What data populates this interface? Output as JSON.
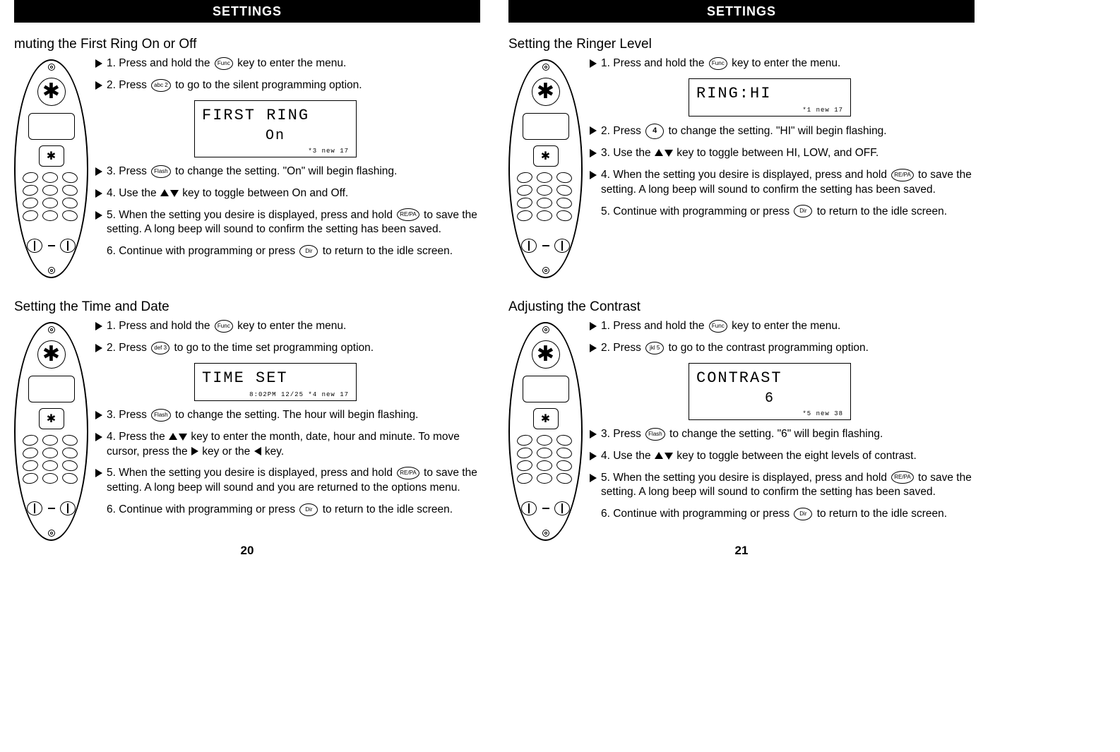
{
  "header": "SETTINGS",
  "page_left_num": "20",
  "page_right_num": "21",
  "buttons": {
    "func": "Func",
    "flash": "Flash",
    "repa": "RE/PA",
    "dir": "Dir",
    "k2": "abc 2",
    "k3": "def 3",
    "k4": "4",
    "k5": "jkl 5"
  },
  "sections": {
    "mute": {
      "title": "muting the First Ring  On or Off",
      "lcd": {
        "l1": "FIRST RING",
        "l2": "On",
        "l3": "*3    new 17"
      },
      "steps": [
        {
          "arrow": true,
          "n": "1.",
          "pre": "Press and hold the",
          "btn": "func",
          "post": "key to enter the menu."
        },
        {
          "arrow": true,
          "n": "2.",
          "pre": "Press",
          "btn": "k2",
          "post": "to go to the silent programming option."
        },
        {
          "arrow": true,
          "n": "3.",
          "pre": "Press",
          "btn": "flash",
          "post": "to change the setting.  \"On\"  will begin flashing."
        },
        {
          "arrow": true,
          "n": "4.",
          "pre": "Use the",
          "updown": true,
          "post": "key to toggle between On and Off."
        },
        {
          "arrow": true,
          "n": "5.",
          "pre": "When the setting you desire is displayed, press and hold",
          "btn": "repa",
          "post": "to save the setting. A long beep will sound to confirm the setting has been saved."
        },
        {
          "arrow": false,
          "n": "6.",
          "pre": "Continue with programming or press",
          "btn": "dir",
          "post": "to return to the idle screen."
        }
      ]
    },
    "time": {
      "title": "Setting the Time and Date",
      "lcd": {
        "l1": "TIME SET",
        "l2": " ",
        "l3": "8:02PM  12/25    *4    new 17"
      },
      "steps": [
        {
          "arrow": true,
          "n": "1.",
          "pre": "Press and hold the",
          "btn": "func",
          "post": "key to enter the menu."
        },
        {
          "arrow": true,
          "n": "2.",
          "pre": "Press",
          "btn": "k3",
          "post": "to go to the time set programming option."
        },
        {
          "arrow": true,
          "n": "3.",
          "pre": "Press",
          "btn": "flash",
          "post": "to change the setting. The hour  will begin flashing."
        },
        {
          "arrow": true,
          "n": "4.",
          "pre": "Press the",
          "updown": true,
          "post": "key to enter the month, date, hour and minute. To move cursor, press the",
          "rtri": true,
          "post2": "key or the",
          "ltri": true,
          "post3": "key."
        },
        {
          "arrow": true,
          "n": "5.",
          "pre": "When the setting you desire is displayed, press and hold",
          "btn": "repa",
          "post": "to save the setting. A long beep will sound and you are returned to the options menu."
        },
        {
          "arrow": false,
          "n": "6.",
          "pre": "Continue with programming or press",
          "btn": "dir",
          "post": "to return to the idle screen."
        }
      ]
    },
    "ringer": {
      "title": "Setting the Ringer Level",
      "lcd": {
        "l1": "RING:HI",
        "l2": " ",
        "l3": "*1    new 17"
      },
      "steps": [
        {
          "arrow": true,
          "n": "1.",
          "pre": "Press and hold the",
          "btn": "func",
          "post": "key to enter the menu."
        },
        {
          "arrow": true,
          "n": "2.",
          "pre": "Press",
          "btn": "k4",
          "big": true,
          "post": "to change the setting.  \"HI\"  will begin flashing."
        },
        {
          "arrow": true,
          "n": "3.",
          "pre": "Use the",
          "updown": true,
          "post": "key to toggle between HI, LOW, and OFF."
        },
        {
          "arrow": true,
          "n": "4.",
          "pre": "When the setting you desire is displayed, press and hold",
          "btn": "repa",
          "post": "to save the setting. A long beep will sound to confirm the setting has been saved."
        },
        {
          "arrow": false,
          "n": "5.",
          "pre": "Continue with programming or press",
          "btn": "dir",
          "post": "to return to the idle screen."
        }
      ]
    },
    "contrast": {
      "title": "Adjusting the Contrast",
      "lcd": {
        "l1": "CONTRAST",
        "l2": "6",
        "l3": "*5    new 38"
      },
      "steps": [
        {
          "arrow": true,
          "n": "1.",
          "pre": "Press and hold the",
          "btn": "func",
          "post": "key to enter the menu."
        },
        {
          "arrow": true,
          "n": "2.",
          "pre": "Press",
          "btn": "k5",
          "post": "to go to the contrast programming option."
        },
        {
          "arrow": true,
          "n": "3.",
          "pre": "Press",
          "btn": "flash",
          "post": "to change the setting.  \"6\"  will begin flashing."
        },
        {
          "arrow": true,
          "n": "4.",
          "pre": "Use the",
          "updown": true,
          "post": "key to toggle between the eight  levels of contrast."
        },
        {
          "arrow": true,
          "n": "5.",
          "pre": "When the setting you desire is displayed, press and hold",
          "btn": "repa",
          "post": "to save the setting. A long beep will sound to confirm the setting has been saved."
        },
        {
          "arrow": false,
          "n": "6.",
          "pre": "Continue with programming or press",
          "btn": "dir",
          "post": "to return to the idle screen."
        }
      ]
    }
  }
}
